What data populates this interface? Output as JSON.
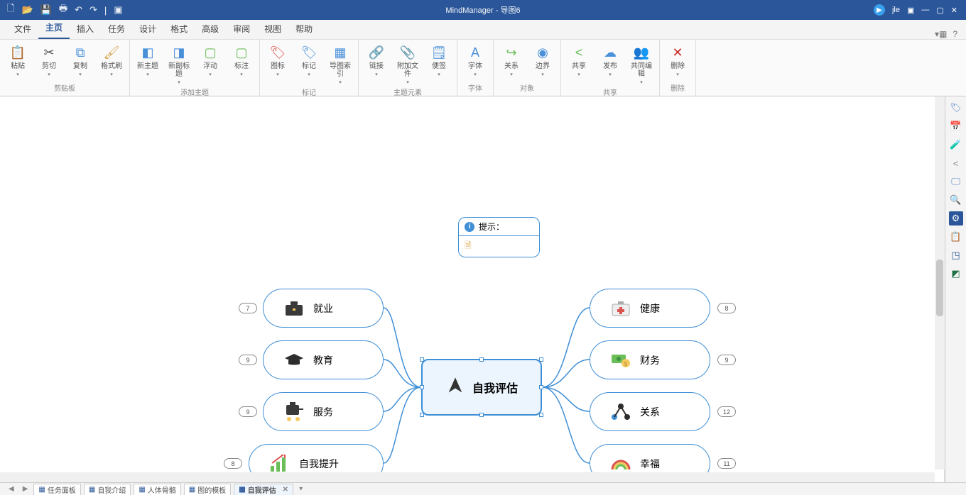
{
  "app": {
    "title": "MindManager - 导图6",
    "user": "jle"
  },
  "menu": {
    "tabs": [
      "文件",
      "主页",
      "插入",
      "任务",
      "设计",
      "格式",
      "高级",
      "审阅",
      "视图",
      "帮助"
    ],
    "active": 1
  },
  "ribbon": {
    "groups": [
      {
        "title": "剪贴板",
        "items": [
          {
            "label": "粘贴",
            "color": "#4a90d9",
            "glyph": "📋"
          },
          {
            "label": "剪切",
            "color": "#555",
            "glyph": "✂"
          },
          {
            "label": "复制",
            "color": "#4a90d9",
            "glyph": "⧉"
          },
          {
            "label": "格式刷",
            "color": "#d9a34a",
            "glyph": "🖌"
          }
        ]
      },
      {
        "title": "添加主题",
        "items": [
          {
            "label": "新主题",
            "color": "#4a90d9",
            "glyph": "◧"
          },
          {
            "label": "新副标题",
            "color": "#4a90d9",
            "glyph": "◨"
          },
          {
            "label": "浮动",
            "color": "#6bbf59",
            "glyph": "▢"
          },
          {
            "label": "标注",
            "color": "#6bbf59",
            "glyph": "▢"
          }
        ]
      },
      {
        "title": "标记",
        "items": [
          {
            "label": "图标",
            "color": "#d9534f",
            "glyph": "🏷"
          },
          {
            "label": "标记",
            "color": "#4a90d9",
            "glyph": "🏷"
          },
          {
            "label": "导图索引",
            "color": "#4a90d9",
            "glyph": "▦"
          }
        ]
      },
      {
        "title": "主题元素",
        "items": [
          {
            "label": "链接",
            "color": "#4a90d9",
            "glyph": "🔗"
          },
          {
            "label": "附加文件",
            "color": "#888",
            "glyph": "📎"
          },
          {
            "label": "便签",
            "color": "#4a90d9",
            "glyph": "🗒"
          }
        ]
      },
      {
        "title": "字体",
        "items": [
          {
            "label": "字体",
            "color": "#4a90d9",
            "glyph": "A"
          }
        ]
      },
      {
        "title": "对象",
        "items": [
          {
            "label": "关系",
            "color": "#6bbf59",
            "glyph": "↪"
          },
          {
            "label": "边界",
            "color": "#4a90d9",
            "glyph": "◉"
          }
        ]
      },
      {
        "title": "共享",
        "items": [
          {
            "label": "共享",
            "color": "#6bbf59",
            "glyph": "<"
          },
          {
            "label": "发布",
            "color": "#4a90d9",
            "glyph": "☁"
          },
          {
            "label": "共同编辑",
            "color": "#4a90d9",
            "glyph": "👥"
          }
        ]
      },
      {
        "title": "删除",
        "items": [
          {
            "label": "删除",
            "color": "#c9302c",
            "glyph": "✕"
          }
        ]
      }
    ]
  },
  "callout": {
    "hint_label": "提示："
  },
  "mindmap": {
    "central": "自我评估",
    "left": [
      {
        "label": "就业",
        "badge": "7"
      },
      {
        "label": "教育",
        "badge": "9"
      },
      {
        "label": "服务",
        "badge": "9"
      },
      {
        "label": "自我提升",
        "badge": "8"
      }
    ],
    "right": [
      {
        "label": "健康",
        "badge": "8"
      },
      {
        "label": "财务",
        "badge": "9"
      },
      {
        "label": "关系",
        "badge": "12"
      },
      {
        "label": "幸福",
        "badge": "11"
      }
    ]
  },
  "bottom": {
    "tabs": [
      "任务面板",
      "自我介绍",
      "人体骨骼",
      "图的模板",
      "自我评估"
    ],
    "active": 4
  }
}
